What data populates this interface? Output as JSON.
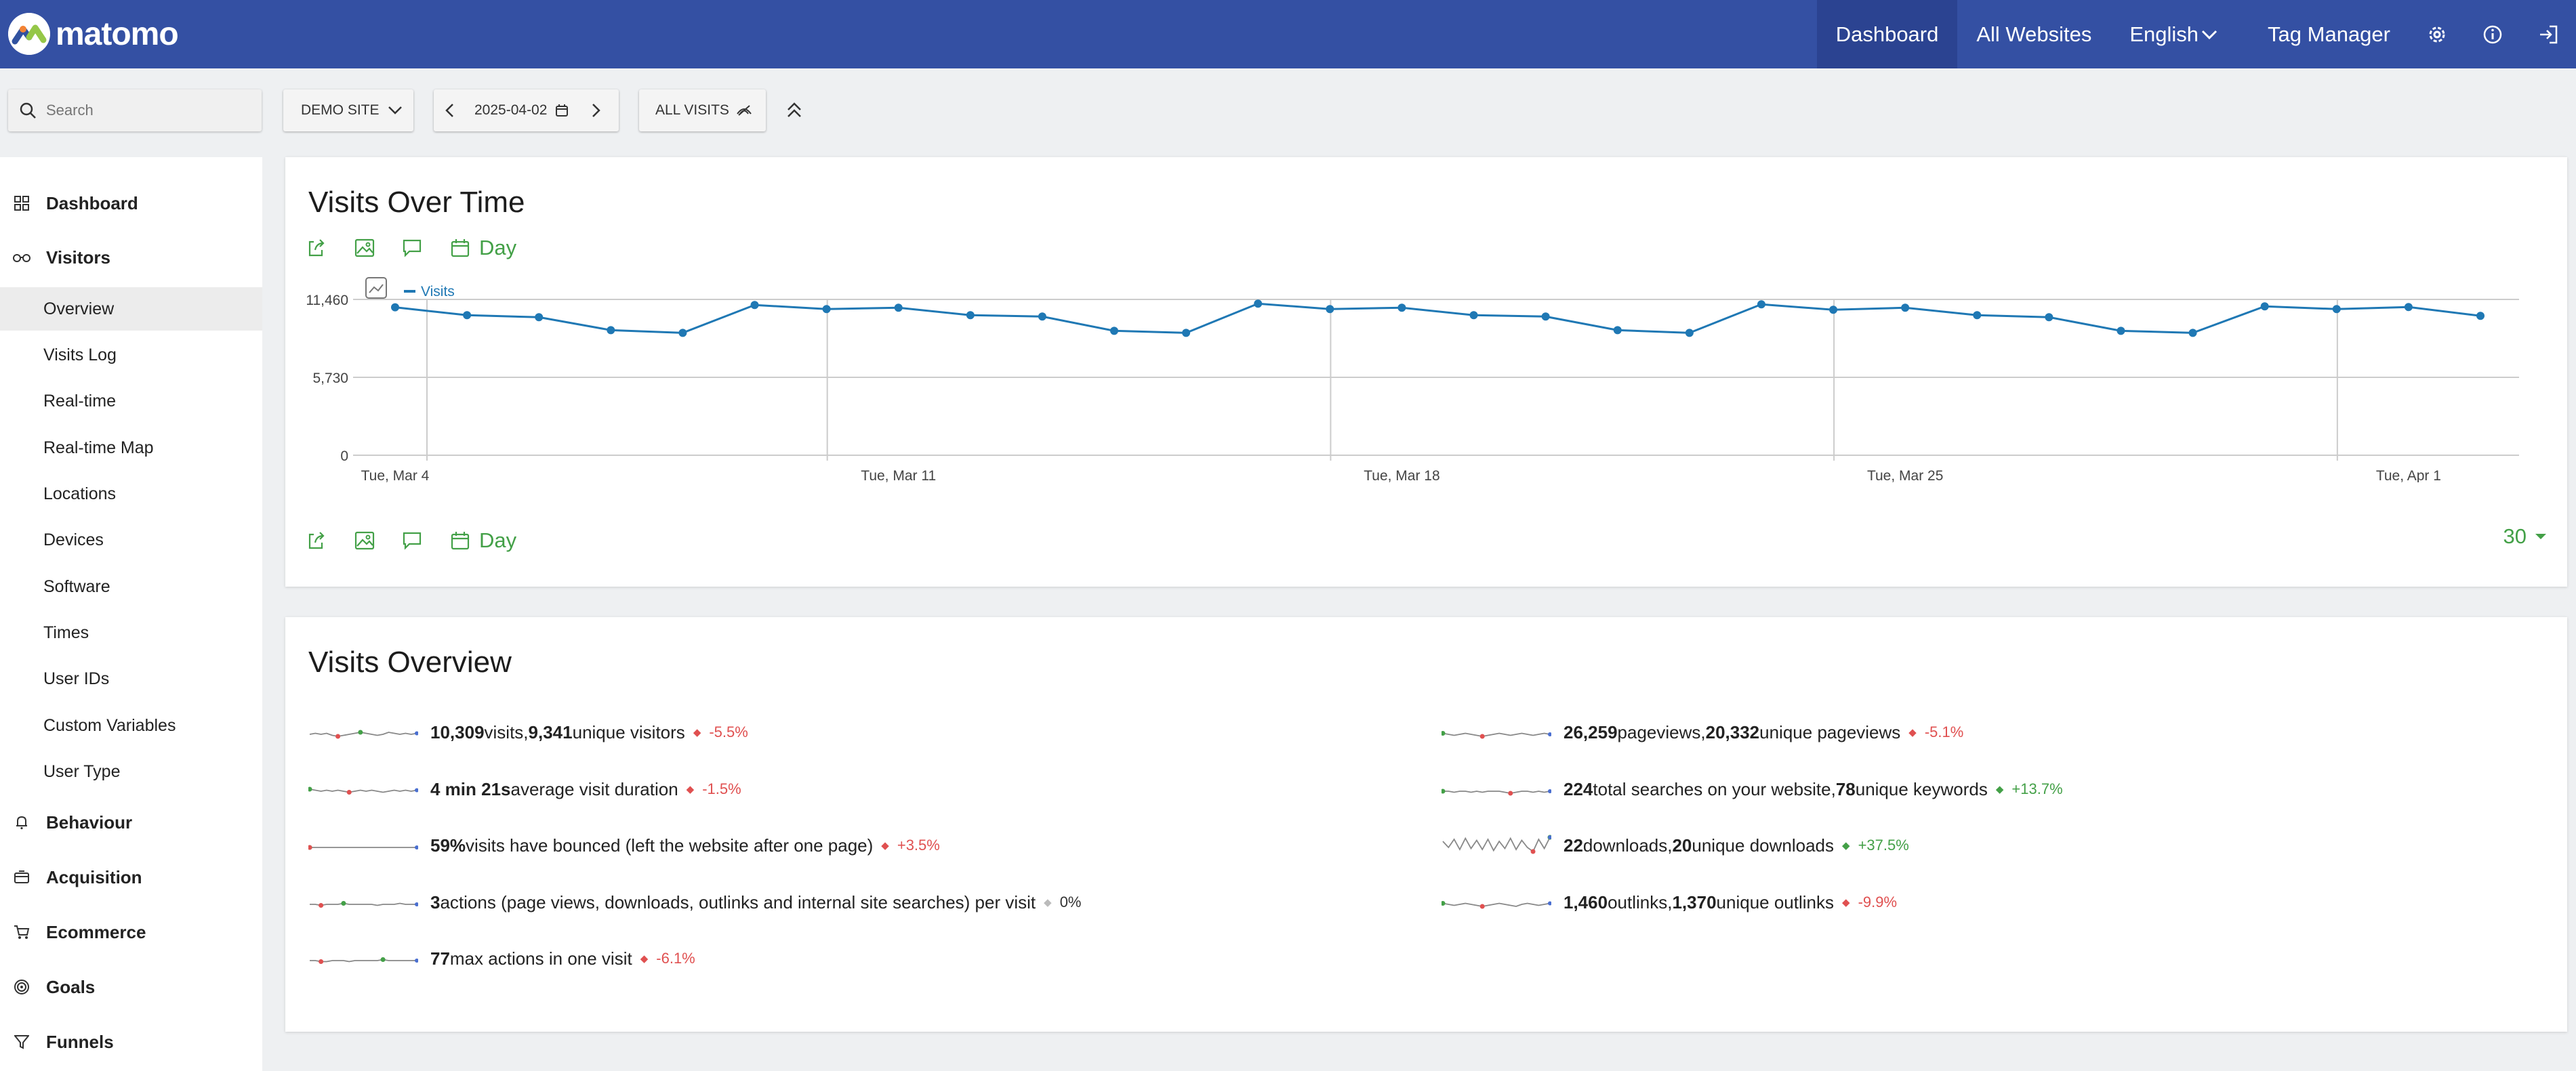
{
  "app": {
    "brand": "matomo",
    "colors": {
      "header": "#3450a3",
      "accent": "#43a047",
      "negative": "#e05050",
      "series": "#1f78b4"
    }
  },
  "topnav": {
    "dashboard": "Dashboard",
    "all_websites": "All Websites",
    "language": "English",
    "tag_manager": "Tag Manager",
    "icons": [
      "gear-icon",
      "info-icon",
      "sign-out-icon"
    ]
  },
  "controls": {
    "search_placeholder": "Search",
    "site": "DEMO SITE",
    "date": "2025-04-02",
    "segment": "ALL VISITS"
  },
  "sidebar": {
    "dashboard": "Dashboard",
    "visitors": "Visitors",
    "visitors_items": [
      "Overview",
      "Visits Log",
      "Real-time",
      "Real-time Map",
      "Locations",
      "Devices",
      "Software",
      "Times",
      "User IDs",
      "Custom Variables",
      "User Type"
    ],
    "behaviour": "Behaviour",
    "acquisition": "Acquisition",
    "ecommerce": "Ecommerce",
    "goals": "Goals",
    "funnels": "Funnels"
  },
  "visits_over_time": {
    "title": "Visits Over Time",
    "period": "Day",
    "limit": "30"
  },
  "chart_data": {
    "type": "line",
    "legend": [
      "Visits"
    ],
    "y_ticks": [
      "11,460",
      "5,730",
      "0"
    ],
    "ylim": [
      0,
      11460
    ],
    "x_tick_labels": [
      "Tue, Mar 4",
      "Tue, Mar 11",
      "Tue, Mar 18",
      "Tue, Mar 25",
      "Tue, Apr 1"
    ],
    "x": [
      "2025-03-04",
      "2025-03-05",
      "2025-03-06",
      "2025-03-07",
      "2025-03-08",
      "2025-03-09",
      "2025-03-10",
      "2025-03-11",
      "2025-03-12",
      "2025-03-13",
      "2025-03-14",
      "2025-03-15",
      "2025-03-16",
      "2025-03-17",
      "2025-03-18",
      "2025-03-19",
      "2025-03-20",
      "2025-03-21",
      "2025-03-22",
      "2025-03-23",
      "2025-03-24",
      "2025-03-25",
      "2025-03-26",
      "2025-03-27",
      "2025-03-28",
      "2025-03-29",
      "2025-03-30",
      "2025-03-31",
      "2025-04-01",
      "2025-04-02"
    ],
    "series": [
      {
        "name": "Visits",
        "values": [
          10880,
          10300,
          10150,
          9200,
          9000,
          11050,
          10750,
          10850,
          10300,
          10200,
          9150,
          9000,
          11150,
          10750,
          10850,
          10300,
          10200,
          9200,
          9000,
          11100,
          10700,
          10850,
          10300,
          10150,
          9150,
          9000,
          10950,
          10750,
          10900,
          10250
        ]
      }
    ]
  },
  "visits_overview": {
    "title": "Visits Overview",
    "left": [
      {
        "v1": "10,309",
        "t1": " visits, ",
        "v2": "9,341",
        "t2": " unique visitors",
        "change": "-5.5%",
        "dir": "neg"
      },
      {
        "v1": "4 min 21s",
        "t1": " average visit duration",
        "v2": "",
        "t2": "",
        "change": "-1.5%",
        "dir": "neg"
      },
      {
        "v1": "59%",
        "t1": " visits have bounced (left the website after one page)",
        "v2": "",
        "t2": "",
        "change": "+3.5%",
        "dir": "neg"
      },
      {
        "v1": "3",
        "t1": " actions (page views, downloads, outlinks and internal site searches) per visit",
        "v2": "",
        "t2": "",
        "change": "0%",
        "dir": "neu"
      },
      {
        "v1": "77",
        "t1": " max actions in one visit",
        "v2": "",
        "t2": "",
        "change": "-6.1%",
        "dir": "neg"
      }
    ],
    "right": [
      {
        "v1": "26,259",
        "t1": " pageviews, ",
        "v2": "20,332",
        "t2": " unique pageviews",
        "change": "-5.1%",
        "dir": "neg"
      },
      {
        "v1": "224",
        "t1": " total searches on your website, ",
        "v2": "78",
        "t2": " unique keywords",
        "change": "+13.7%",
        "dir": "pos"
      },
      {
        "v1": "22",
        "t1": " downloads, ",
        "v2": "20",
        "t2": " unique downloads",
        "change": "+37.5%",
        "dir": "pos"
      },
      {
        "v1": "1,460",
        "t1": " outlinks, ",
        "v2": "1,370",
        "t2": " unique outlinks",
        "change": "-9.9%",
        "dir": "neg"
      }
    ]
  }
}
